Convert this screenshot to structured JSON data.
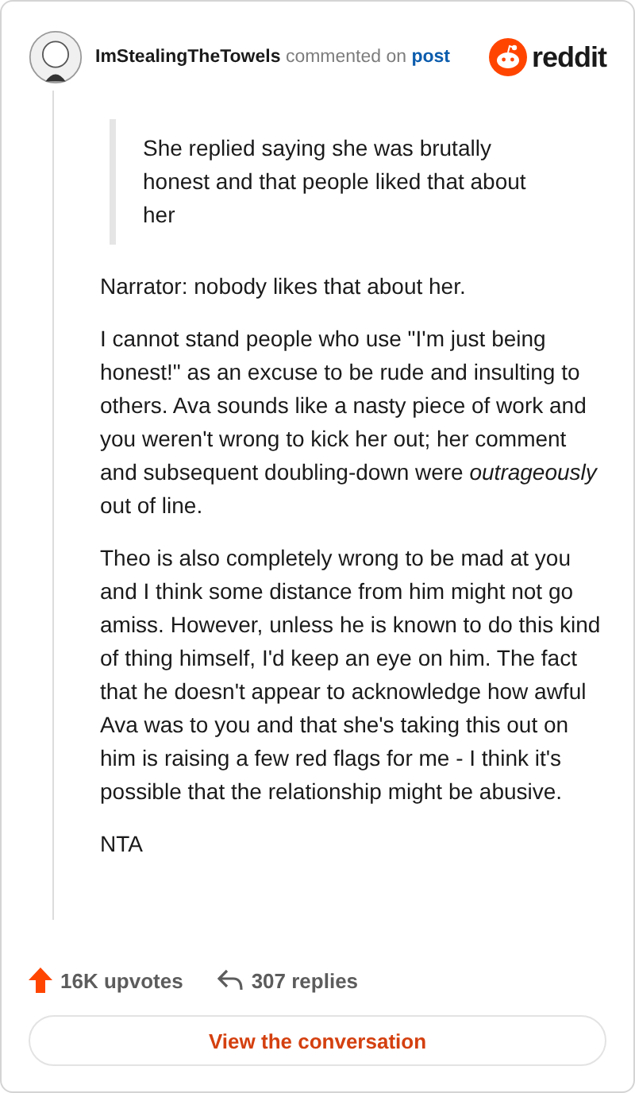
{
  "header": {
    "username": "ImStealingTheTowels",
    "action": "commented on",
    "link": "post",
    "brand": "reddit"
  },
  "quote": "She replied saying she was brutally honest and that people liked that about her",
  "paragraphs": [
    "Narrator: nobody likes that about her.",
    "I cannot stand people who use \"I'm just being honest!\" as an excuse to be rude and insulting to others. Ava sounds like a nasty piece of work and you weren't wrong to kick her out; her comment and subsequent doubling-down were *outrageously* out of line.",
    "Theo is also completely wrong to be mad at you and I think some distance from him might not go amiss. However, unless he is known to do this kind of thing himself, I'd keep an eye on him. The fact that he doesn't appear to acknowledge how awful Ava was to you and that she's taking this out on him is raising a few red flags for me - I think it's possible that the relationship might be abusive.",
    "NTA"
  ],
  "stats": {
    "upvotes": "16K upvotes",
    "replies": "307 replies"
  },
  "button": "View the conversation"
}
